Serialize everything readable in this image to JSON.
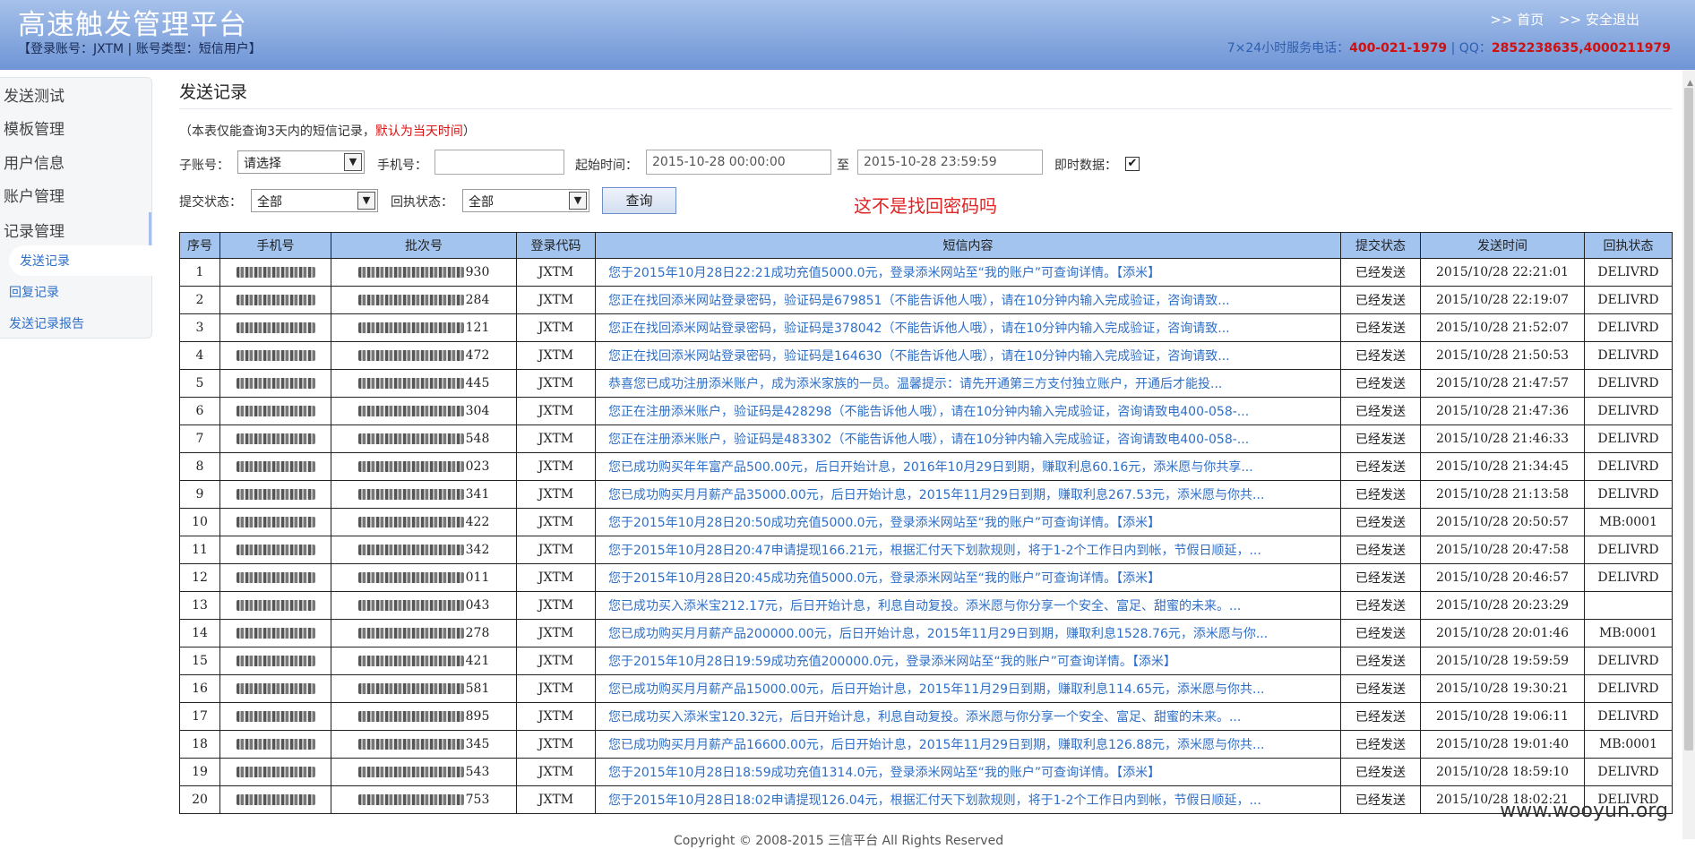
{
  "header": {
    "title": "高速触发管理平台",
    "account_info": "【登录账号：JXTM | 账号类型：短信用户】",
    "links": [
      ">> 首页",
      ">> 安全退出"
    ],
    "service_prefix": "7×24小时服务电话：",
    "service_phone": "400-021-1979",
    "qq_prefix": " | QQ：",
    "qq_numbers": "2852238635,4000211979"
  },
  "sidebar": {
    "items": [
      "发送测试",
      "模板管理",
      "用户信息",
      "账户管理",
      "记录管理"
    ],
    "sub_items": [
      "发送记录",
      "回复记录",
      "发送记录报告"
    ]
  },
  "page": {
    "title": "发送记录",
    "notice_prefix": "（本表仅能查询3天内的短信记录，",
    "notice_red": "默认为当天时间",
    "notice_suffix": "）",
    "annotation": "这不是找回密码吗"
  },
  "filters": {
    "sub_account_label": "子账号：",
    "sub_account_value": "请选择",
    "phone_label": "手机号：",
    "phone_value": "",
    "start_label": "起始时间：",
    "start_value": "2015-10-28 00:00:00",
    "to_label": "至",
    "end_value": "2015-10-28 23:59:59",
    "realtime_label": "即时数据：",
    "realtime_checked": "✔",
    "submit_status_label": "提交状态：",
    "submit_status_value": "全部",
    "receipt_status_label": "回执状态：",
    "receipt_status_value": "全部",
    "query_button": "查询"
  },
  "table": {
    "headers": [
      "序号",
      "手机号",
      "批次号",
      "登录代码",
      "短信内容",
      "提交状态",
      "发送时间",
      "回执状态"
    ],
    "rows": [
      {
        "no": "1",
        "batch_tail": "930",
        "code": "JXTM",
        "content": "您于2015年10月28日22:21成功充值5000.0元，登录添米网站至“我的账户”可查询详情。【添米】",
        "status": "已经发送",
        "time": "2015/10/28 22:21:01",
        "receipt": "DELIVRD"
      },
      {
        "no": "2",
        "batch_tail": "284",
        "code": "JXTM",
        "content": "您正在找回添米网站登录密码，验证码是679851（不能告诉他人哦），请在10分钟内输入完成验证，咨询请致...",
        "status": "已经发送",
        "time": "2015/10/28 22:19:07",
        "receipt": "DELIVRD"
      },
      {
        "no": "3",
        "batch_tail": "121",
        "code": "JXTM",
        "content": "您正在找回添米网站登录密码，验证码是378042（不能告诉他人哦），请在10分钟内输入完成验证，咨询请致...",
        "status": "已经发送",
        "time": "2015/10/28 21:52:07",
        "receipt": "DELIVRD"
      },
      {
        "no": "4",
        "batch_tail": "472",
        "code": "JXTM",
        "content": "您正在找回添米网站登录密码，验证码是164630（不能告诉他人哦），请在10分钟内输入完成验证，咨询请致...",
        "status": "已经发送",
        "time": "2015/10/28 21:50:53",
        "receipt": "DELIVRD"
      },
      {
        "no": "5",
        "batch_tail": "445",
        "code": "JXTM",
        "content": "恭喜您已成功注册添米账户，成为添米家族的一员。温馨提示：请先开通第三方支付独立账户，开通后才能投...",
        "status": "已经发送",
        "time": "2015/10/28 21:47:57",
        "receipt": "DELIVRD"
      },
      {
        "no": "6",
        "batch_tail": "304",
        "code": "JXTM",
        "content": "您正在注册添米账户，验证码是428298（不能告诉他人哦），请在10分钟内输入完成验证，咨询请致电400-058-...",
        "status": "已经发送",
        "time": "2015/10/28 21:47:36",
        "receipt": "DELIVRD"
      },
      {
        "no": "7",
        "batch_tail": "548",
        "code": "JXTM",
        "content": "您正在注册添米账户，验证码是483302（不能告诉他人哦），请在10分钟内输入完成验证，咨询请致电400-058-...",
        "status": "已经发送",
        "time": "2015/10/28 21:46:33",
        "receipt": "DELIVRD"
      },
      {
        "no": "8",
        "batch_tail": "023",
        "code": "JXTM",
        "content": "您已成功购买年年富产品500.00元，后日开始计息，2016年10月29日到期，赚取利息60.16元，添米愿与你共享...",
        "status": "已经发送",
        "time": "2015/10/28 21:34:45",
        "receipt": "DELIVRD"
      },
      {
        "no": "9",
        "batch_tail": "341",
        "code": "JXTM",
        "content": "您已成功购买月月薪产品35000.00元，后日开始计息，2015年11月29日到期，赚取利息267.53元，添米愿与你共...",
        "status": "已经发送",
        "time": "2015/10/28 21:13:58",
        "receipt": "DELIVRD"
      },
      {
        "no": "10",
        "batch_tail": "422",
        "code": "JXTM",
        "content": "您于2015年10月28日20:50成功充值5000.0元，登录添米网站至“我的账户”可查询详情。【添米】",
        "status": "已经发送",
        "time": "2015/10/28 20:50:57",
        "receipt": "MB:0001"
      },
      {
        "no": "11",
        "batch_tail": "342",
        "code": "JXTM",
        "content": "您于2015年10月28日20:47申请提现166.21元，根据汇付天下划款规则，将于1-2个工作日内到帐，节假日顺延，...",
        "status": "已经发送",
        "time": "2015/10/28 20:47:58",
        "receipt": "DELIVRD"
      },
      {
        "no": "12",
        "batch_tail": "011",
        "code": "JXTM",
        "content": "您于2015年10月28日20:45成功充值5000.0元，登录添米网站至“我的账户”可查询详情。【添米】",
        "status": "已经发送",
        "time": "2015/10/28 20:46:57",
        "receipt": "DELIVRD"
      },
      {
        "no": "13",
        "batch_tail": "043",
        "code": "JXTM",
        "content": "您已成功买入添米宝212.17元，后日开始计息，利息自动复投。添米愿与你分享一个安全、富足、甜蜜的未来。...",
        "status": "已经发送",
        "time": "2015/10/28 20:23:29",
        "receipt": ""
      },
      {
        "no": "14",
        "batch_tail": "278",
        "code": "JXTM",
        "content": "您已成功购买月月薪产品200000.00元，后日开始计息，2015年11月29日到期，赚取利息1528.76元，添米愿与你...",
        "status": "已经发送",
        "time": "2015/10/28 20:01:46",
        "receipt": "MB:0001"
      },
      {
        "no": "15",
        "batch_tail": "421",
        "code": "JXTM",
        "content": "您于2015年10月28日19:59成功充值200000.0元，登录添米网站至“我的账户”可查询详情。【添米】",
        "status": "已经发送",
        "time": "2015/10/28 19:59:59",
        "receipt": "DELIVRD"
      },
      {
        "no": "16",
        "batch_tail": "581",
        "code": "JXTM",
        "content": "您已成功购买月月薪产品15000.00元，后日开始计息，2015年11月29日到期，赚取利息114.65元，添米愿与你共...",
        "status": "已经发送",
        "time": "2015/10/28 19:30:21",
        "receipt": "DELIVRD"
      },
      {
        "no": "17",
        "batch_tail": "895",
        "code": "JXTM",
        "content": "您已成功买入添米宝120.32元，后日开始计息，利息自动复投。添米愿与你分享一个安全、富足、甜蜜的未来。...",
        "status": "已经发送",
        "time": "2015/10/28 19:06:11",
        "receipt": "DELIVRD"
      },
      {
        "no": "18",
        "batch_tail": "345",
        "code": "JXTM",
        "content": "您已成功购买月月薪产品16600.00元，后日开始计息，2015年11月29日到期，赚取利息126.88元，添米愿与你共...",
        "status": "已经发送",
        "time": "2015/10/28 19:01:40",
        "receipt": "MB:0001"
      },
      {
        "no": "19",
        "batch_tail": "543",
        "code": "JXTM",
        "content": "您于2015年10月28日18:59成功充值1314.0元，登录添米网站至“我的账户”可查询详情。【添米】",
        "status": "已经发送",
        "time": "2015/10/28 18:59:10",
        "receipt": "DELIVRD"
      },
      {
        "no": "20",
        "batch_tail": "753",
        "code": "JXTM",
        "content": "您于2015年10月28日18:02申请提现126.04元，根据汇付天下划款规则，将于1-2个工作日内到帐，节假日顺延，...",
        "status": "已经发送",
        "time": "2015/10/28 18:02:21",
        "receipt": "DELIVRD"
      }
    ]
  },
  "footer": {
    "copyright": "Copyright © 2008-2015 三信平台 All Rights Reserved",
    "watermark": "www.wooyun.org"
  },
  "colors": {
    "header_top": "#a6c1ea",
    "header_bottom": "#6f95d6",
    "table_header": "#a3c4ee",
    "link_blue": "#2e6fc7",
    "alert_red": "#e02424"
  }
}
